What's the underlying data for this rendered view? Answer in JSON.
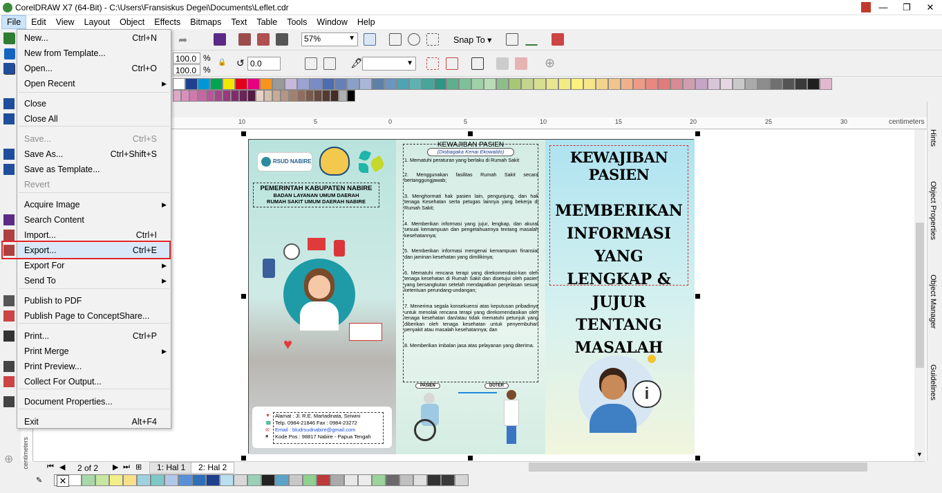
{
  "window": {
    "title": "CorelDRAW X7 (64-Bit) - C:\\Users\\Fransiskus Degei\\Documents\\Leflet.cdr",
    "minimize": "—",
    "maximize": "❐",
    "close": "✕"
  },
  "menubar": [
    "File",
    "Edit",
    "View",
    "Layout",
    "Object",
    "Effects",
    "Bitmaps",
    "Text",
    "Table",
    "Tools",
    "Window",
    "Help"
  ],
  "toolbar": {
    "zoom": "57%",
    "snap_to": "Snap To"
  },
  "propbar": {
    "scale_w": "100.0",
    "scale_h": "100.0",
    "pct": "%",
    "rotate": "0.0"
  },
  "file_menu": [
    {
      "label": "New...",
      "shortcut": "Ctrl+N",
      "disabled": false
    },
    {
      "label": "New from Template...",
      "shortcut": "",
      "disabled": false
    },
    {
      "label": "Open...",
      "shortcut": "Ctrl+O",
      "disabled": false
    },
    {
      "label": "Open Recent",
      "shortcut": "",
      "disabled": false,
      "submenu": true
    },
    {
      "label": "Close",
      "shortcut": "",
      "disabled": false
    },
    {
      "label": "Close All",
      "shortcut": "",
      "disabled": false
    },
    {
      "label": "Save...",
      "shortcut": "Ctrl+S",
      "disabled": true
    },
    {
      "label": "Save As...",
      "shortcut": "Ctrl+Shift+S",
      "disabled": false
    },
    {
      "label": "Save as Template...",
      "shortcut": "",
      "disabled": false
    },
    {
      "label": "Revert",
      "shortcut": "",
      "disabled": true
    },
    {
      "label": "Acquire Image",
      "shortcut": "",
      "disabled": false,
      "submenu": true
    },
    {
      "label": "Search Content",
      "shortcut": "",
      "disabled": false
    },
    {
      "label": "Import...",
      "shortcut": "Ctrl+I",
      "disabled": false
    },
    {
      "label": "Export...",
      "shortcut": "Ctrl+E",
      "disabled": false
    },
    {
      "label": "Export For",
      "shortcut": "",
      "disabled": false,
      "submenu": true
    },
    {
      "label": "Send To",
      "shortcut": "",
      "disabled": false,
      "submenu": true
    },
    {
      "label": "Publish to PDF",
      "shortcut": "",
      "disabled": false
    },
    {
      "label": "Publish Page to ConceptShare...",
      "shortcut": "",
      "disabled": false
    },
    {
      "label": "Print...",
      "shortcut": "Ctrl+P",
      "disabled": false
    },
    {
      "label": "Print Merge",
      "shortcut": "",
      "disabled": false,
      "submenu": true
    },
    {
      "label": "Print Preview...",
      "shortcut": "",
      "disabled": false
    },
    {
      "label": "Collect For Output...",
      "shortcut": "",
      "disabled": false
    },
    {
      "label": "Document Properties...",
      "shortcut": "",
      "disabled": false
    },
    {
      "label": "Exit",
      "shortcut": "Alt+F4",
      "disabled": false
    }
  ],
  "ruler": {
    "unit": "centimeters",
    "ticks": [
      "10",
      "5",
      "0",
      "5",
      "10",
      "15",
      "20",
      "25",
      "30"
    ],
    "vertical_unit": "centimeters"
  },
  "dockers": [
    "Hints",
    "Object Properties",
    "Object Manager",
    "Guidelines"
  ],
  "pages": {
    "counter": "2 of 2",
    "tab1": "1: Hal 1",
    "tab2": "2: Hal 2"
  },
  "leaflet": {
    "logo_text": "RSUD NABIRE",
    "gov_title": "PEMERINTAH KABUPATEN NABIRE",
    "gov_sub1": "BADAN LAYANAN UMUM DAERAH",
    "gov_sub2": "RUMAH SAKIT UMUM DAERAH NABIRE",
    "contact": [
      "Alamat : Jl. R.E. Martadinata, Siriwini",
      "Telp. 0984-21846 Fax : 0984-23272",
      "Email : bludrsudnabire@gmail.com",
      "Kode Pos : 98817 Nabire - Papua Tengah"
    ],
    "p2_title": "KEWAJIBAN PASIEN",
    "p2_subtitle": "(Diobagaka Kenai Ekowaldo)",
    "p2_items": [
      "1. Mematuhi peraturan yang berlaku di Rumah Sakit",
      "2. Menggunakan fasilitas Rumah Sakit secara bertanggungjawab;",
      "3. Menghormati hak pasien lain, pengunjung, dan hak tenaga Kesehatan serta petugas lainnya yang bekerja di Rumah Sakit;",
      "4. Memberikan informasi yang jujur, lengkap, dan akurat sesuai kemampuan dan pengetahuannya tentang masalah kesehatannya;",
      "5. Memberikan informasi mengenai kemampuan finansial dan jaminan kesehatan yang dimilikinya;",
      "6. Mematuhi rencana terapi yang direkomendasi-kan oleh tenaga kesehatan di Rumah Sakit dan disetujui oleh pasien yang bersangkutan setelah mendapatkan penjelasan sesuai ketentuan perundang-undangan;",
      "7. Menerima segala konsekuensi atas keputusan pribadinya untuk menolak rencana terapi yang direkomendasikan oleh tenaga kesehatan dan/atau tidak mematuhi petunjuk yang diberikan oleh tenaga kesehatan untuk penyembuhan penyakit atau masalah kesehatannya; dan",
      "8. Memberikan imbalan jasa atas pelayanan yang diterima."
    ],
    "label_patient": "PASIEN",
    "label_doctor": "DOTER",
    "p3_title": "KEWAJIBAN PASIEN",
    "p3_body": "MEMBERIKAN INFORMASI YANG LENGKAP & JUJUR TENTANG MASALAH"
  },
  "colors": {
    "highlight_border": "#e0242a",
    "menu_bg": "#f2f2f2"
  }
}
